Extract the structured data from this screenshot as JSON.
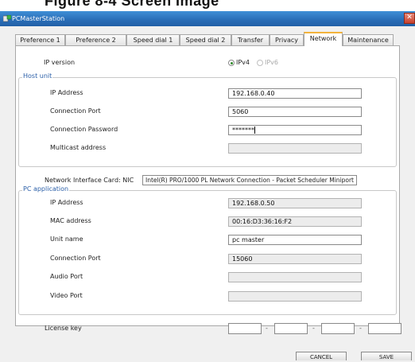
{
  "caption": {
    "text": "Figure 8-4  Screen Image"
  },
  "window": {
    "title": "PCMasterStation",
    "close_glyph": "✕"
  },
  "tabs": [
    {
      "label": "Preference 1"
    },
    {
      "label": "Preference 2"
    },
    {
      "label": "Speed dial 1"
    },
    {
      "label": "Speed dial 2"
    },
    {
      "label": "Transfer"
    },
    {
      "label": "Privacy"
    },
    {
      "label": "Network",
      "active": true
    },
    {
      "label": "Maintenance"
    }
  ],
  "ip_version": {
    "label": "IP version",
    "options": [
      {
        "label": "IPv4",
        "selected": true,
        "enabled": true
      },
      {
        "label": "IPv6",
        "selected": false,
        "enabled": false
      }
    ]
  },
  "host_unit": {
    "title": "Host unit",
    "ip_address": {
      "label": "IP Address",
      "value": "192.168.0.40"
    },
    "connection_port": {
      "label": "Connection Port",
      "value": "5060"
    },
    "connection_password": {
      "label": "Connection Password",
      "value": "*******"
    },
    "multicast_address": {
      "label": "Multicast address",
      "value": ""
    }
  },
  "nic": {
    "label": "Network Interface Card: NIC",
    "value": "Intel(R) PRO/1000 PL Network Connection - Packet Scheduler Miniport"
  },
  "pc_application": {
    "title": "PC application",
    "ip_address": {
      "label": "IP Address",
      "value": "192.168.0.50"
    },
    "mac_address": {
      "label": "MAC address",
      "value": "00:16:D3:36:16:F2"
    },
    "unit_name": {
      "label": "Unit name",
      "value": "pc master"
    },
    "connection_port": {
      "label": "Connection Port",
      "value": "15060"
    },
    "audio_port": {
      "label": "Audio Port",
      "value": ""
    },
    "video_port": {
      "label": "Video Port",
      "value": ""
    }
  },
  "license_key": {
    "label": "License key",
    "separator": "-",
    "segments": [
      "",
      "",
      "",
      ""
    ]
  },
  "buttons": {
    "cancel": "CANCEL",
    "save": "SAVE"
  },
  "colors": {
    "titlebar": "#2a6fb8",
    "group_title": "#2b5fa8",
    "active_tab_accent": "#f2b33c",
    "radio_selected": "#2f8a2a"
  }
}
